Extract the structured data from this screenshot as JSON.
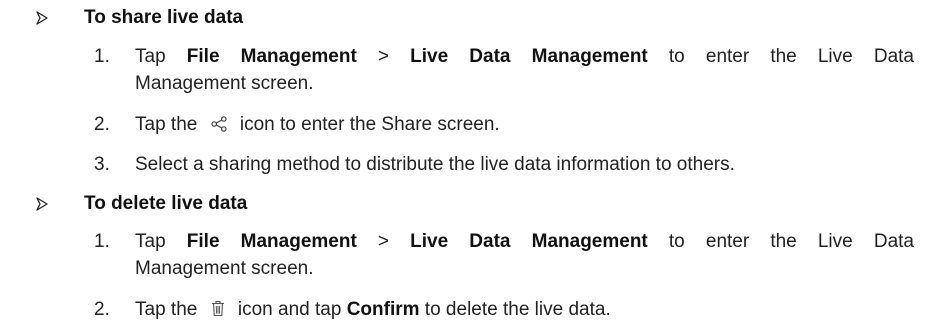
{
  "sections": [
    {
      "heading": "To share live data",
      "steps": [
        {
          "num": "1.",
          "tap": "Tap ",
          "item1": "File Management",
          "sep": " > ",
          "item2": "Live Data Management",
          "rest_line1": " to enter the Live Data",
          "line2": "Management screen."
        },
        {
          "num": "2.",
          "before_icon": "Tap the",
          "icon": "share-icon",
          "after_icon": "icon to enter the Share screen."
        },
        {
          "num": "3.",
          "text": "Select a sharing method to distribute the live data information to others."
        }
      ]
    },
    {
      "heading": "To delete live data",
      "steps": [
        {
          "num": "1.",
          "tap": "Tap ",
          "item1": "File Management",
          "sep": " > ",
          "item2": "Live Data Management",
          "rest_line1": " to enter the Live Data",
          "line2": "Management screen."
        },
        {
          "num": "2.",
          "before_icon": "Tap the",
          "icon": "trash-icon",
          "after_icon_1": "icon and tap ",
          "confirm": "Confirm",
          "after_icon_2": " to delete the live data."
        }
      ]
    }
  ]
}
